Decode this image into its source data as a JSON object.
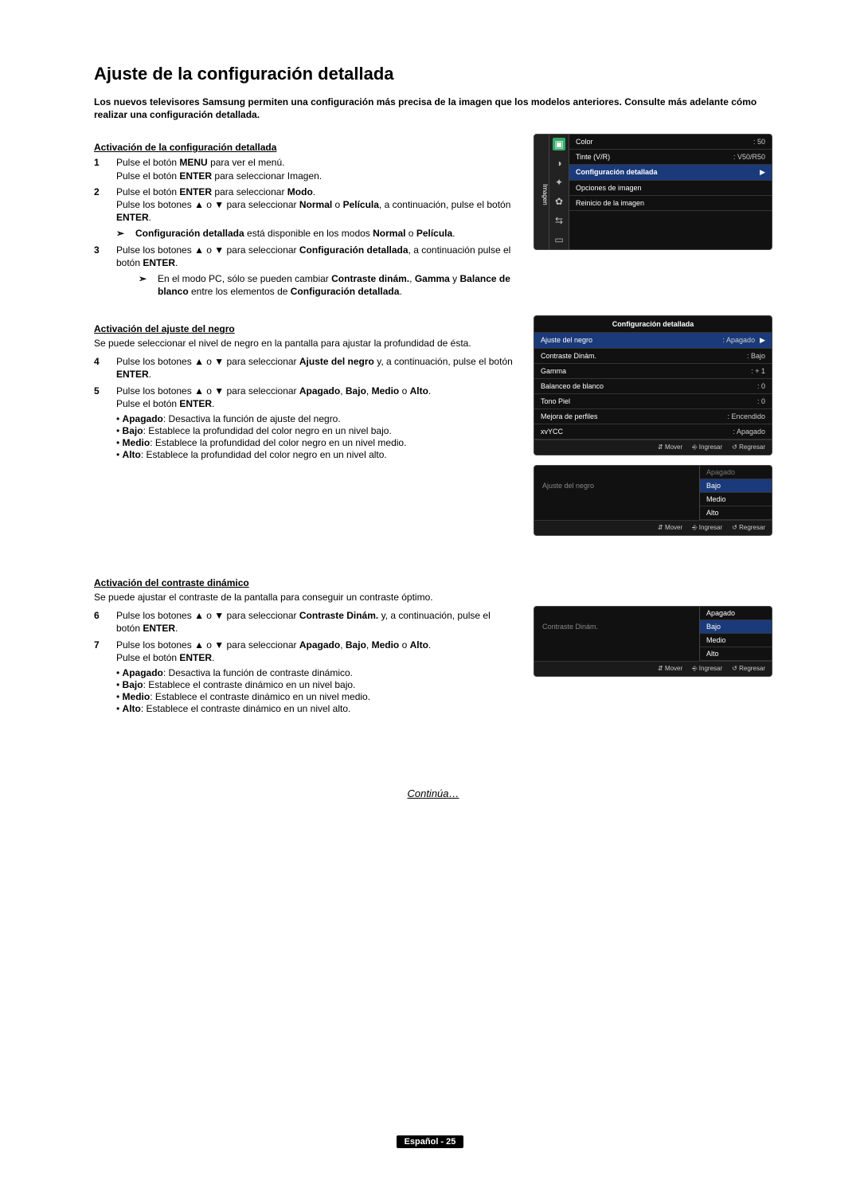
{
  "title": "Ajuste de la configuración detallada",
  "intro": "Los nuevos televisores Samsung permiten una configuración más precisa de la imagen que los modelos anteriores. Consulte más adelante cómo realizar una configuración detallada.",
  "section_a": {
    "head": "Activación de la configuración detallada",
    "steps": [
      {
        "n": "1",
        "html": "Pulse el botón <b>MENU</b> para ver el menú.<br>Pulse el botón <b>ENTER</b> para seleccionar Imagen."
      },
      {
        "n": "2",
        "html": "Pulse el botón <b>ENTER</b> para seleccionar <b>Modo</b>.<br>Pulse los botones ▲ o ▼ para seleccionar <b>Normal</b> o <b>Película</b>, a continuación, pulse el botón <b>ENTER</b>."
      }
    ],
    "note1": "<b>Configuración detallada</b> está disponible en los modos <b>Normal</b> o <b>Película</b>.",
    "step3": {
      "n": "3",
      "html": "Pulse los botones ▲ o ▼ para seleccionar <b>Configuración detallada</b>, a continuación pulse el botón <b>ENTER</b>."
    },
    "note2": "En el modo PC, sólo se pueden cambiar <b>Contraste dinám.</b>, <b>Gamma</b> y <b>Balance de blanco</b> entre los elementos de <b>Configuración detallada</b>."
  },
  "section_b": {
    "head": "Activación del ajuste del negro",
    "lead": "Se puede seleccionar el nivel de negro en la pantalla para ajustar la profundidad de ésta.",
    "steps": [
      {
        "n": "4",
        "html": "Pulse los botones ▲ o ▼ para seleccionar <b>Ajuste del negro</b> y, a continuación, pulse el botón <b>ENTER</b>."
      },
      {
        "n": "5",
        "html": "Pulse los botones ▲ o ▼ para seleccionar <b>Apagado</b>, <b>Bajo</b>, <b>Medio</b> o <b>Alto</b>.<br>Pulse el botón <b>ENTER</b>."
      }
    ],
    "bullets": [
      {
        "k": "Apagado",
        "t": ": Desactiva la función de ajuste del negro."
      },
      {
        "k": "Bajo",
        "t": ": Establece la profundidad del color negro en un nivel bajo."
      },
      {
        "k": "Medio",
        "t": ": Establece la profundidad del color negro en un nivel medio."
      },
      {
        "k": "Alto",
        "t": ": Establece la profundidad del color negro en un nivel alto."
      }
    ]
  },
  "section_c": {
    "head": "Activación del contraste dinámico",
    "lead": "Se puede ajustar el contraste de la pantalla para conseguir un contraste óptimo.",
    "steps": [
      {
        "n": "6",
        "html": "Pulse los botones ▲ o ▼ para seleccionar <b>Contraste Dinám.</b> y, a continuación, pulse el botón <b>ENTER</b>."
      },
      {
        "n": "7",
        "html": "Pulse los botones ▲ o ▼ para seleccionar <b>Apagado</b>, <b>Bajo</b>, <b>Medio</b> o <b>Alto</b>.<br>Pulse el botón <b>ENTER</b>."
      }
    ],
    "bullets": [
      {
        "k": "Apagado",
        "t": ": Desactiva la función de contraste dinámico."
      },
      {
        "k": "Bajo",
        "t": ": Establece el contraste dinámico en un nivel bajo."
      },
      {
        "k": "Medio",
        "t": ": Establece el contraste dinámico en un nivel medio."
      },
      {
        "k": "Alto",
        "t": ": Establece el contraste dinámico en un nivel alto."
      }
    ]
  },
  "continua": "Continúa…",
  "footer": "Español - 25",
  "osd1": {
    "tab": "Imagen",
    "rows_top": [
      {
        "lab": "Color",
        "val": ": 50"
      },
      {
        "lab": "Tinte (V/R)",
        "val": ": V50/R50"
      }
    ],
    "sel_row": "Configuración detallada",
    "rows_bot": [
      "Opciones de imagen",
      "Reinicio de la imagen"
    ]
  },
  "osd2": {
    "title": "Configuración detallada",
    "rows": [
      {
        "lab": "Ajuste del negro",
        "val": ": Apagado",
        "sel": true
      },
      {
        "lab": "Contraste Dinám.",
        "val": ": Bajo"
      },
      {
        "lab": "Gamma",
        "val": ": + 1"
      },
      {
        "lab": "Balanceo de blanco",
        "val": ": 0"
      },
      {
        "lab": "Tono Piel",
        "val": ": 0"
      },
      {
        "lab": "Mejora de perfiles",
        "val": ": Encendido"
      },
      {
        "lab": "xvYCC",
        "val": ": Apagado"
      }
    ],
    "footer": {
      "mover": "Mover",
      "ingresar": "Ingresar",
      "regresar": "Regresar"
    }
  },
  "osd3": {
    "left": "Ajuste del negro",
    "opts": [
      {
        "t": "Apagado",
        "dim": true
      },
      {
        "t": "Bajo",
        "sel": true
      },
      {
        "t": "Medio"
      },
      {
        "t": "Alto"
      }
    ],
    "footer": {
      "mover": "Mover",
      "ingresar": "Ingresar",
      "regresar": "Regresar"
    }
  },
  "osd4": {
    "left": "Contraste Dinám.",
    "opts": [
      {
        "t": "Apagado"
      },
      {
        "t": "Bajo",
        "dim": true,
        "sel": true
      },
      {
        "t": "Medio"
      },
      {
        "t": "Alto"
      }
    ],
    "footer": {
      "mover": "Mover",
      "ingresar": "Ingresar",
      "regresar": "Regresar"
    }
  }
}
